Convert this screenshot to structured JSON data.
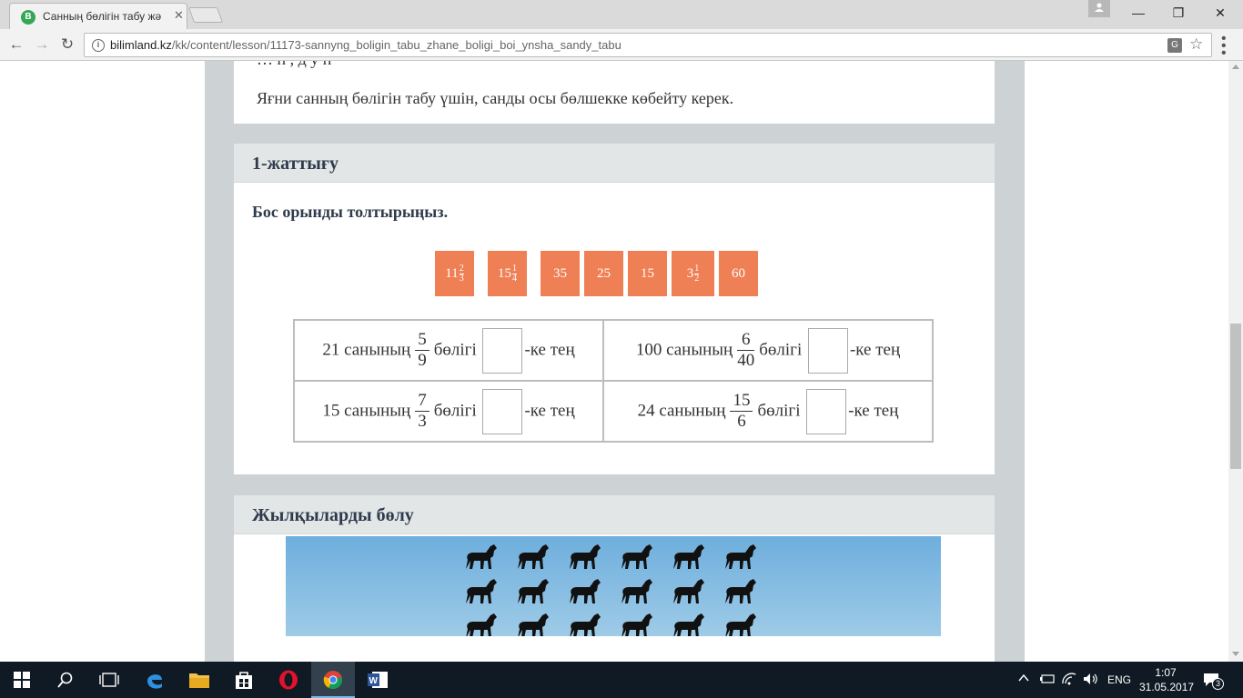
{
  "browser": {
    "tab_title": "Санның бөлігін табу жә",
    "tab_favicon_letter": "B",
    "tab_close": "✕",
    "url_domain": "bilimland.kz",
    "url_path": "/kk/content/lesson/11173-sannyng_boligin_tabu_zhane_boligi_boi_ynsha_sandy_tabu",
    "win_min": "—",
    "win_restore": "❐",
    "win_close": "✕",
    "nav_back": "←",
    "nav_forward": "→",
    "nav_reload": "↻",
    "star": "☆",
    "translate": "G"
  },
  "intro": {
    "cut_line": "…  п         ,  д  у       п",
    "text": "Яғни санның бөлігін табу үшін, санды осы бөлшекке көбейту керек."
  },
  "exercise": {
    "title": "1-жаттығу",
    "instruction": "Бос орынды толтырыңыз.",
    "chips": [
      {
        "whole": "11",
        "num": "2",
        "den": "3"
      },
      {
        "whole": "15",
        "num": "1",
        "den": "4"
      },
      {
        "whole": "35"
      },
      {
        "whole": "25"
      },
      {
        "whole": "15"
      },
      {
        "whole": "3",
        "num": "1",
        "den": "2"
      },
      {
        "whole": "60"
      }
    ],
    "rows": [
      [
        {
          "prefix": "21 санының",
          "num": "5",
          "den": "9",
          "mid": "бөлігі",
          "suffix": "-ке тең"
        },
        {
          "prefix": "100 санының",
          "num": "6",
          "den": "40",
          "mid": "бөлігі",
          "suffix": "-ке тең"
        }
      ],
      [
        {
          "prefix": "15 санының",
          "num": "7",
          "den": "3",
          "mid": "бөлігі",
          "suffix": "-ке тең"
        },
        {
          "prefix": "24 санының",
          "num": "15",
          "den": "6",
          "mid": "бөлігі",
          "suffix": "-ке тең"
        }
      ]
    ]
  },
  "horses_section": {
    "title": "Жылқыларды бөлу"
  },
  "taskbar": {
    "lang": "ENG",
    "time": "1:07",
    "date": "31.05.2017",
    "notifications": "3"
  },
  "colors": {
    "chip": "#ef7f55",
    "heading": "#2f3b4c",
    "page_bg": "#cdd2d4"
  }
}
